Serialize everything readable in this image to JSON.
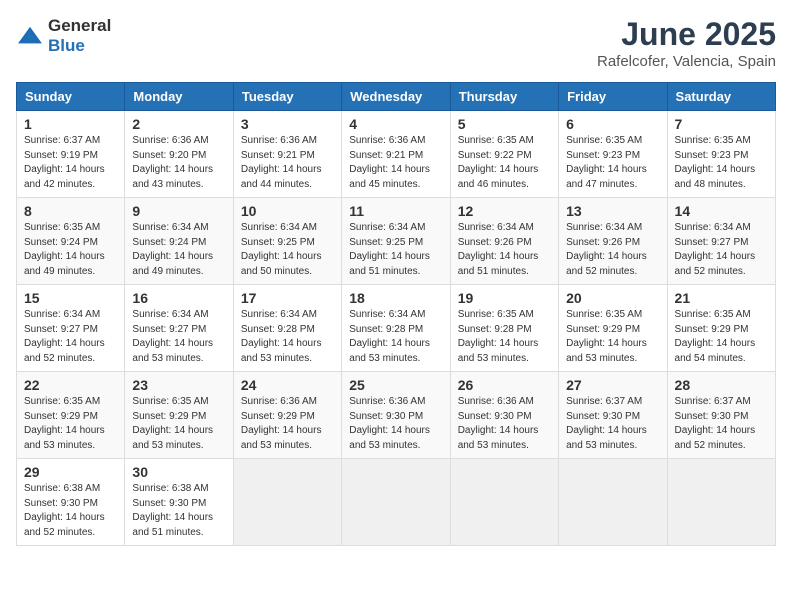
{
  "logo": {
    "general": "General",
    "blue": "Blue"
  },
  "header": {
    "month": "June 2025",
    "location": "Rafelcofer, Valencia, Spain"
  },
  "weekdays": [
    "Sunday",
    "Monday",
    "Tuesday",
    "Wednesday",
    "Thursday",
    "Friday",
    "Saturday"
  ],
  "weeks": [
    [
      {
        "day": "1",
        "sunrise": "6:37 AM",
        "sunset": "9:19 PM",
        "daylight": "14 hours and 42 minutes."
      },
      {
        "day": "2",
        "sunrise": "6:36 AM",
        "sunset": "9:20 PM",
        "daylight": "14 hours and 43 minutes."
      },
      {
        "day": "3",
        "sunrise": "6:36 AM",
        "sunset": "9:21 PM",
        "daylight": "14 hours and 44 minutes."
      },
      {
        "day": "4",
        "sunrise": "6:36 AM",
        "sunset": "9:21 PM",
        "daylight": "14 hours and 45 minutes."
      },
      {
        "day": "5",
        "sunrise": "6:35 AM",
        "sunset": "9:22 PM",
        "daylight": "14 hours and 46 minutes."
      },
      {
        "day": "6",
        "sunrise": "6:35 AM",
        "sunset": "9:23 PM",
        "daylight": "14 hours and 47 minutes."
      },
      {
        "day": "7",
        "sunrise": "6:35 AM",
        "sunset": "9:23 PM",
        "daylight": "14 hours and 48 minutes."
      }
    ],
    [
      {
        "day": "8",
        "sunrise": "6:35 AM",
        "sunset": "9:24 PM",
        "daylight": "14 hours and 49 minutes."
      },
      {
        "day": "9",
        "sunrise": "6:34 AM",
        "sunset": "9:24 PM",
        "daylight": "14 hours and 49 minutes."
      },
      {
        "day": "10",
        "sunrise": "6:34 AM",
        "sunset": "9:25 PM",
        "daylight": "14 hours and 50 minutes."
      },
      {
        "day": "11",
        "sunrise": "6:34 AM",
        "sunset": "9:25 PM",
        "daylight": "14 hours and 51 minutes."
      },
      {
        "day": "12",
        "sunrise": "6:34 AM",
        "sunset": "9:26 PM",
        "daylight": "14 hours and 51 minutes."
      },
      {
        "day": "13",
        "sunrise": "6:34 AM",
        "sunset": "9:26 PM",
        "daylight": "14 hours and 52 minutes."
      },
      {
        "day": "14",
        "sunrise": "6:34 AM",
        "sunset": "9:27 PM",
        "daylight": "14 hours and 52 minutes."
      }
    ],
    [
      {
        "day": "15",
        "sunrise": "6:34 AM",
        "sunset": "9:27 PM",
        "daylight": "14 hours and 52 minutes."
      },
      {
        "day": "16",
        "sunrise": "6:34 AM",
        "sunset": "9:27 PM",
        "daylight": "14 hours and 53 minutes."
      },
      {
        "day": "17",
        "sunrise": "6:34 AM",
        "sunset": "9:28 PM",
        "daylight": "14 hours and 53 minutes."
      },
      {
        "day": "18",
        "sunrise": "6:34 AM",
        "sunset": "9:28 PM",
        "daylight": "14 hours and 53 minutes."
      },
      {
        "day": "19",
        "sunrise": "6:35 AM",
        "sunset": "9:28 PM",
        "daylight": "14 hours and 53 minutes."
      },
      {
        "day": "20",
        "sunrise": "6:35 AM",
        "sunset": "9:29 PM",
        "daylight": "14 hours and 53 minutes."
      },
      {
        "day": "21",
        "sunrise": "6:35 AM",
        "sunset": "9:29 PM",
        "daylight": "14 hours and 54 minutes."
      }
    ],
    [
      {
        "day": "22",
        "sunrise": "6:35 AM",
        "sunset": "9:29 PM",
        "daylight": "14 hours and 53 minutes."
      },
      {
        "day": "23",
        "sunrise": "6:35 AM",
        "sunset": "9:29 PM",
        "daylight": "14 hours and 53 minutes."
      },
      {
        "day": "24",
        "sunrise": "6:36 AM",
        "sunset": "9:29 PM",
        "daylight": "14 hours and 53 minutes."
      },
      {
        "day": "25",
        "sunrise": "6:36 AM",
        "sunset": "9:30 PM",
        "daylight": "14 hours and 53 minutes."
      },
      {
        "day": "26",
        "sunrise": "6:36 AM",
        "sunset": "9:30 PM",
        "daylight": "14 hours and 53 minutes."
      },
      {
        "day": "27",
        "sunrise": "6:37 AM",
        "sunset": "9:30 PM",
        "daylight": "14 hours and 53 minutes."
      },
      {
        "day": "28",
        "sunrise": "6:37 AM",
        "sunset": "9:30 PM",
        "daylight": "14 hours and 52 minutes."
      }
    ],
    [
      {
        "day": "29",
        "sunrise": "6:38 AM",
        "sunset": "9:30 PM",
        "daylight": "14 hours and 52 minutes."
      },
      {
        "day": "30",
        "sunrise": "6:38 AM",
        "sunset": "9:30 PM",
        "daylight": "14 hours and 51 minutes."
      },
      null,
      null,
      null,
      null,
      null
    ]
  ]
}
